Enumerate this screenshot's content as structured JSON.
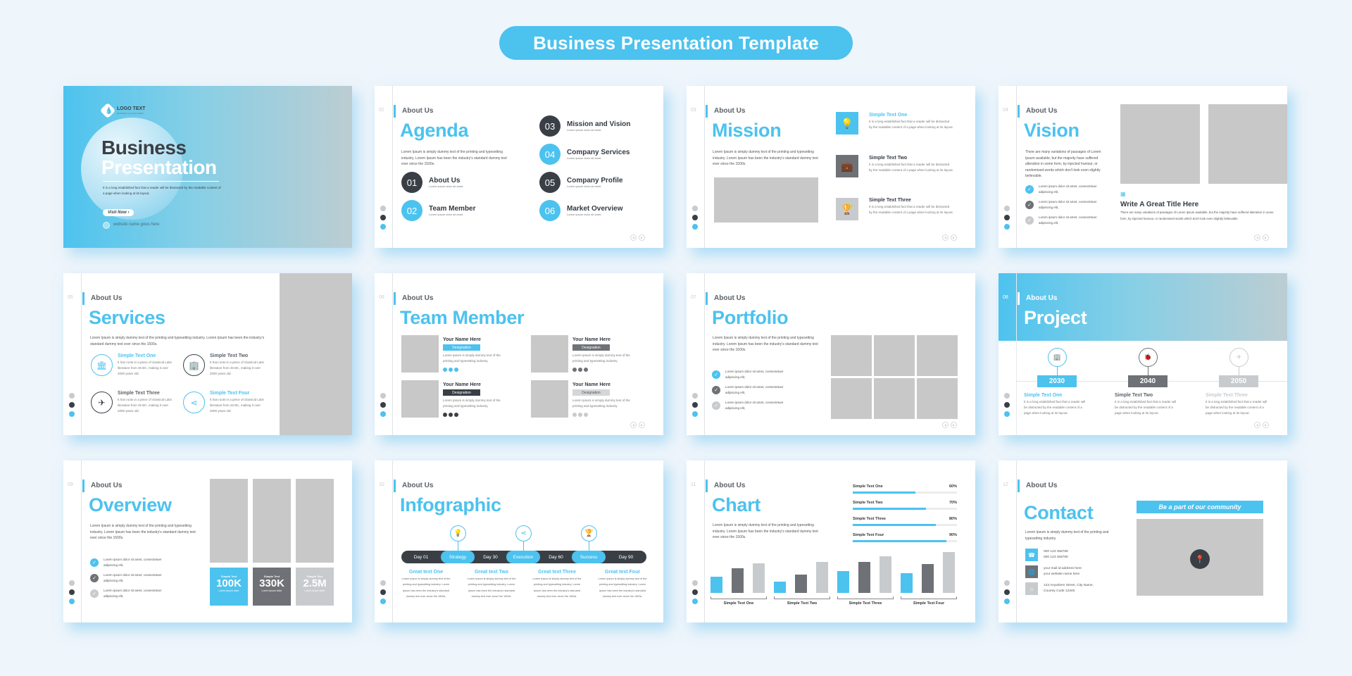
{
  "header": {
    "title": "Business Presentation Template"
  },
  "colors": {
    "accent": "#4cc2ef",
    "dark": "#3a3f46",
    "mid": "#6e7175",
    "light": "#c8cbce",
    "placeholder": "#c8c8c8"
  },
  "common": {
    "about": "About Us",
    "prev_icon": "◂",
    "next_icon": "▸"
  },
  "slides": {
    "cover": {
      "logo_text": "LOGO TEXT",
      "logo_sub": "BUSINESS SLOGAN HERE",
      "logo_icon": "💧",
      "title_line1": "Business",
      "title_line2": "Presentation",
      "description": "It is a long established fact that a reader will be distracted by the readable content of a page when looking at its layout.",
      "button": "Visit Now ›",
      "website": "website name goes here"
    },
    "agenda": {
      "number": "02",
      "title": "Agenda",
      "description": "Lorem Ipsum is simply dummy text of the printing and typesetting industry. Lorem Ipsum has been the industry's standard dummy text ever since the 1500s.",
      "items": [
        {
          "num": "01",
          "label": "About Us",
          "sub": "Lorem ipsum dolor sit amet."
        },
        {
          "num": "02",
          "label": "Team Member",
          "sub": "Lorem ipsum dolor sit amet."
        },
        {
          "num": "03",
          "label": "Mission and Vision",
          "sub": "Lorem ipsum dolor sit amet."
        },
        {
          "num": "04",
          "label": "Company Services",
          "sub": "Lorem ipsum dolor sit amet."
        },
        {
          "num": "05",
          "label": "Company Profile",
          "sub": "Lorem ipsum dolor sit amet."
        },
        {
          "num": "06",
          "label": "Market Overview",
          "sub": "Lorem ipsum dolor sit amet."
        }
      ]
    },
    "mission": {
      "number": "03",
      "title": "Mission",
      "description": "Lorem Ipsum is simply dummy text of the printing and typesetting industry. Lorem Ipsum has been the industry's standard dummy text ever since the 1500s.",
      "features": [
        {
          "title": "Simple Text One",
          "icon": "lightbulb",
          "glyph": "💡",
          "desc": "It is a long established fact that a reader will be distracted by the readable content of a page when looking at its layout."
        },
        {
          "title": "Simple Text Two",
          "icon": "briefcase",
          "glyph": "💼",
          "desc": "It is a long established fact that a reader will be distracted by the readable content of a page when looking at its layout."
        },
        {
          "title": "Simple Text Three",
          "icon": "trophy",
          "glyph": "🏆",
          "desc": "It is a long established fact that a reader will be distracted by the readable content of a page when looking at its layout."
        }
      ]
    },
    "vision": {
      "number": "04",
      "title": "Vision",
      "description": "There are many variations of passages of Lorem Ipsum available, but the majority have suffered alteration in some form, by injected humour, or randomised words which don't look even slightly believable.",
      "checks": [
        "Lorem ipsum dolor sit amet, consectetuer adipiscing elit,",
        "Lorem ipsum dolor sit amet, consectetuer adipiscing elit,",
        "Lorem ipsum dolor sit amet, consectetuer adipiscing elit,"
      ],
      "feature_title": "Write A Great Title Here",
      "feature_desc": "There are many variations of passages of Lorem Ipsum available, but the majority have suffered alteration in some form, by injected humour, or randomised words which don't look even slightly believable."
    },
    "services": {
      "number": "05",
      "title": "Services",
      "description": "Lorem Ipsum is simply dummy text of the printing and typesetting industry. Lorem Ipsum has been the industry's standard dummy text ever since the 1500s.",
      "items": [
        {
          "title": "Simple Text One",
          "icon": "bank",
          "glyph": "🏛",
          "desc": "It has roots in a piece of classical Latin literature from 45 BC, making it over 2000 years old."
        },
        {
          "title": "Simple Text Two",
          "icon": "building",
          "glyph": "🏢",
          "desc": "It has roots in a piece of classical Latin literature from 45 BC, making it over 2000 years old."
        },
        {
          "title": "Simple Text Three",
          "icon": "paper-plane",
          "glyph": "✈",
          "desc": "It has roots in a piece of classical Latin literature from 45 BC, making it over 2000 years old."
        },
        {
          "title": "Simple Text Four",
          "icon": "share",
          "glyph": "⋖",
          "desc": "It has roots in a piece of classical Latin literature from 45 BC, making it over 2000 years old."
        }
      ]
    },
    "team": {
      "number": "06",
      "title": "Team Member",
      "members": [
        {
          "name": "Your Name Here",
          "designation": "Designation",
          "desc": "Lorem Ipsum is simply dummy text of the printing and typesetting industry."
        },
        {
          "name": "Your Name Here",
          "designation": "Designation",
          "desc": "Lorem Ipsum is simply dummy text of the printing and typesetting industry."
        },
        {
          "name": "Your Name Here",
          "designation": "Designation",
          "desc": "Lorem Ipsum is simply dummy text of the printing and typesetting industry."
        },
        {
          "name": "Your Name Here",
          "designation": "Designation",
          "desc": "Lorem Ipsum is simply dummy text of the printing and typesetting industry."
        }
      ]
    },
    "portfolio": {
      "number": "07",
      "title": "Portfolio",
      "description": "Lorem Ipsum is simply dummy text of the printing and typesetting industry. Lorem Ipsum has been the industry's standard dummy text ever since the 1500s.",
      "checks": [
        "Lorem ipsum dolor sit amet, consectetuer adipiscing elit,",
        "Lorem ipsum dolor sit amet, consectetuer adipiscing elit,",
        "Lorem ipsum dolor sit amet, consectetuer adipiscing elit,"
      ]
    },
    "project": {
      "number": "08",
      "title": "Project",
      "milestones": [
        {
          "year": "2030",
          "title": "Simple Text One",
          "icon": "building",
          "glyph": "🏢",
          "desc": "It is a long established fact that a reader will be distracted by the readable content of a page when looking at its layout."
        },
        {
          "year": "2040",
          "title": "Simple Text Two",
          "icon": "bug",
          "glyph": "🐞",
          "desc": "It is a long established fact that a reader will be distracted by the readable content of a page when looking at its layout."
        },
        {
          "year": "2050",
          "title": "Simple Text Three",
          "icon": "paper-plane",
          "glyph": "✈",
          "desc": "It is a long established fact that a reader will be distracted by the readable content of a page when looking at its layout."
        }
      ]
    },
    "overview": {
      "number": "09",
      "title": "Overview",
      "description": "Lorem Ipsum is simply dummy text of the printing and typesetting industry. Lorem Ipsum has been the industry's standard dummy text ever since the 1500s.",
      "checks": [
        "Lorem ipsum dolor sit amet, consectetuer adipiscing elit,",
        "Lorem ipsum dolor sit amet, consectetuer adipiscing elit,",
        "Lorem ipsum dolor sit amet, consectetuer adipiscing elit,"
      ],
      "stats": [
        {
          "label": "Simple Text",
          "value": "100K",
          "sub": "Lorem ipsum dolor"
        },
        {
          "label": "Simple Text",
          "value": "330K",
          "sub": "Lorem ipsum dolor"
        },
        {
          "label": "Simple Text",
          "value": "2.5M",
          "sub": "Lorem ipsum dolor"
        }
      ]
    },
    "infographic": {
      "number": "10",
      "title": "Infographic",
      "timeline": [
        "Day 01",
        "Strategy",
        "Day 30",
        "Execution",
        "Day 60",
        "Success",
        "Day 90"
      ],
      "pins": [
        {
          "icon": "lightbulb",
          "glyph": "💡"
        },
        {
          "icon": "share",
          "glyph": "⋖"
        },
        {
          "icon": "trophy",
          "glyph": "🏆"
        }
      ],
      "columns": [
        {
          "title": "Great text One",
          "desc": "Lorem Ipsum is simply dummy text of the printing and typesetting industry. Lorem Ipsum has been the industry's standard dummy text ever since the 1500s."
        },
        {
          "title": "Great text Two",
          "desc": "Lorem Ipsum is simply dummy text of the printing and typesetting industry. Lorem Ipsum has been the industry's standard dummy text ever since the 1500s."
        },
        {
          "title": "Great text Three",
          "desc": "Lorem Ipsum is simply dummy text of the printing and typesetting industry. Lorem Ipsum has been the industry's standard dummy text ever since the 1500s."
        },
        {
          "title": "Great text Four",
          "desc": "Lorem Ipsum is simply dummy text of the printing and typesetting industry. Lorem Ipsum has been the industry's standard dummy text ever since the 1500s."
        }
      ]
    },
    "chart": {
      "number": "11",
      "title": "Chart",
      "description": "Lorem Ipsum is simply dummy text of the printing and typesetting industry. Lorem Ipsum has been the industry's standard dummy text ever since the 1500s.",
      "progress": [
        {
          "label": "Simple Text One",
          "value": 60,
          "text": "60%"
        },
        {
          "label": "Simple Text Two",
          "value": 70,
          "text": "70%"
        },
        {
          "label": "Simple Text Three",
          "value": 80,
          "text": "80%"
        },
        {
          "label": "Simple Text Four",
          "value": 90,
          "text": "90%"
        }
      ]
    },
    "contact": {
      "number": "12",
      "title": "Contact",
      "description": "Lorem Ipsum is simply dummy text of the printing and typesetting industry.",
      "rows": [
        {
          "icon": "phone",
          "glyph": "☎",
          "line1": "000 123 456789",
          "line2": "000 123 456780"
        },
        {
          "icon": "globe",
          "glyph": "🌐",
          "line1": "your mail id address here",
          "line2": "your website name here"
        },
        {
          "icon": "home",
          "glyph": "⌂",
          "line1": "123 Anywhere Street, City Name,",
          "line2": "Country Code 12345"
        }
      ],
      "banner": "Be a part of our community",
      "map_icon": "📍"
    }
  },
  "chart_data": {
    "type": "bar",
    "title": "",
    "xlabel": "",
    "ylabel": "",
    "categories": [
      "Simple Text One",
      "Simple Text Two",
      "Simple Text Three",
      "Simple Text Four"
    ],
    "series": [
      {
        "name": "Series A (blue)",
        "values": [
          19,
          13,
          26,
          23
        ]
      },
      {
        "name": "Series B (dark gray)",
        "values": [
          29,
          22,
          37,
          34
        ]
      },
      {
        "name": "Series C (light gray)",
        "values": [
          35,
          37,
          43,
          48
        ]
      }
    ],
    "ylim": [
      0,
      50
    ],
    "grid": false,
    "legend": "none"
  }
}
